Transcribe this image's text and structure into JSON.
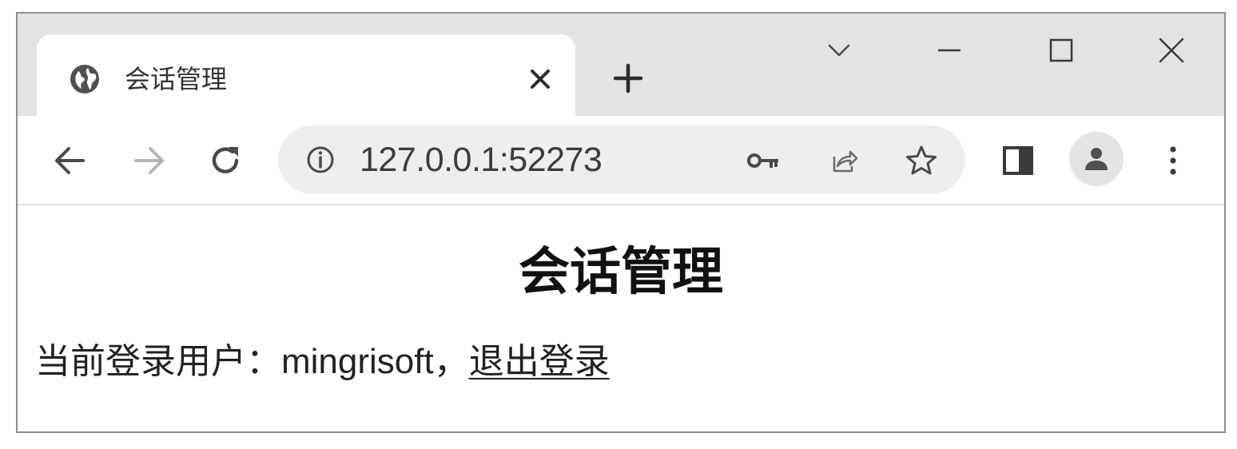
{
  "tab": {
    "title": "会话管理",
    "favicon_icon": "globe-icon",
    "close_icon": "close-icon"
  },
  "new_tab_icon": "plus-icon",
  "window_controls": {
    "tab_search_icon": "chevron-down-icon",
    "minimize_icon": "minimize-icon",
    "maximize_icon": "maximize-icon",
    "close_icon": "close-icon"
  },
  "toolbar": {
    "back_icon": "arrow-left-icon",
    "forward_icon": "arrow-right-icon",
    "reload_icon": "reload-icon",
    "url": "127.0.0.1:52273",
    "site_info_icon": "info-icon",
    "password_icon": "key-icon",
    "share_icon": "share-icon",
    "bookmark_icon": "star-icon",
    "side_panel_icon": "side-panel-icon",
    "profile_icon": "person-icon",
    "menu_icon": "kebab-menu-icon"
  },
  "page": {
    "heading": "会话管理",
    "current_user_label": "当前登录用户：",
    "username": "mingrisoft",
    "separator": "，",
    "logout_link": "退出登录"
  },
  "colors": {
    "tabstrip_bg": "#e3e3e3",
    "omnibox_bg": "#eeeeee",
    "icon_dark": "#4a4a4a",
    "icon_disabled": "#b5b5b5"
  }
}
